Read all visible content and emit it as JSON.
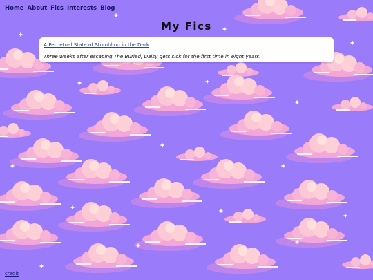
{
  "nav": {
    "links": [
      "Home",
      "About",
      "Fics",
      "Interests",
      "Blog"
    ]
  },
  "page": {
    "title": "My Fics"
  },
  "fics": [
    {
      "title": "A Perpetual State of Stumbling in the Dark",
      "summary": "Three weeks after escaping The Buried, Daisy gets sick for the first time in eight years."
    }
  ],
  "footer": {
    "credit_label": "credit"
  },
  "theme": {
    "background": "#9a7cfb",
    "cloud_light": "#ffd6d9",
    "cloud_pink": "#f6a8d6",
    "cloud_shadow": "#d58ae8",
    "link": "#1a4aa8"
  }
}
